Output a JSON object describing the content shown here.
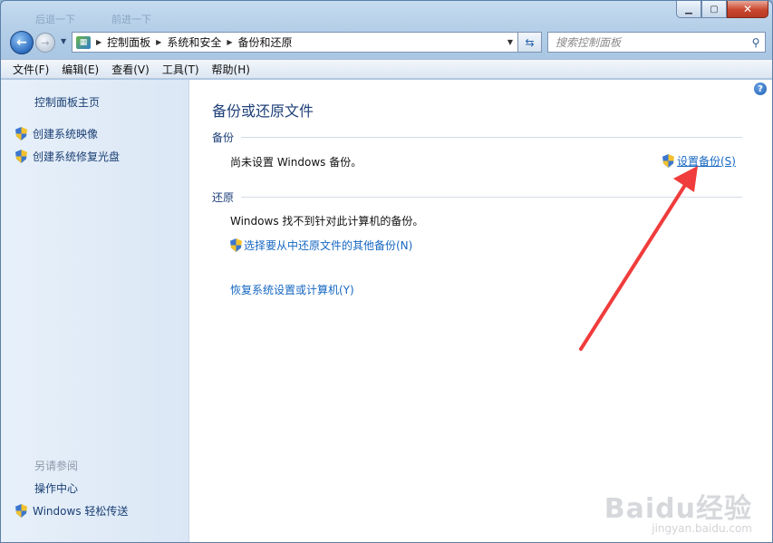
{
  "window": {
    "ghost_titles": [
      "后退一下",
      "前进一下"
    ]
  },
  "nav": {
    "breadcrumbs": [
      "控制面板",
      "系统和安全",
      "备份和还原"
    ],
    "search_placeholder": "搜索控制面板"
  },
  "menubar": {
    "items": [
      "文件(F)",
      "编辑(E)",
      "查看(V)",
      "工具(T)",
      "帮助(H)"
    ]
  },
  "leftpane": {
    "home_link": "控制面板主页",
    "tasks": [
      "创建系统映像",
      "创建系统修复光盘"
    ],
    "see_also_heading": "另请参阅",
    "see_also": [
      "操作中心",
      "Windows 轻松传送"
    ]
  },
  "content": {
    "title": "备份或还原文件",
    "backup_heading": "备份",
    "backup_status": "尚未设置 Windows 备份。",
    "setup_backup_link": "设置备份(S)",
    "restore_heading": "还原",
    "restore_status": "Windows 找不到针对此计算机的备份。",
    "select_other_backup_link": "选择要从中还原文件的其他备份(N)",
    "recover_system_link": "恢复系统设置或计算机(Y)"
  },
  "watermark": {
    "logo": "Baidu经验",
    "url": "jingyan.baidu.com"
  },
  "colors": {
    "link": "#1667c2",
    "heading": "#1e3f78",
    "arrow": "#f03c3c"
  }
}
